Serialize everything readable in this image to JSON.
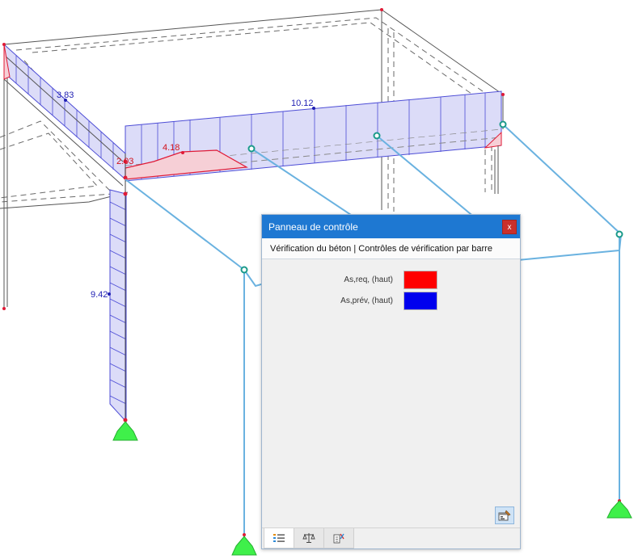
{
  "diagram": {
    "labels": {
      "left_beam_value": "3.83",
      "front_beam_value": "10.12",
      "red_peak_value": "4.18",
      "red_end_value": "2.03",
      "column_value": "9.42"
    },
    "colors": {
      "member_line": "#5b5b5b",
      "dashed_edge": "#6a6a6a",
      "reinforcement_blue_fill": "#dcdcf8",
      "reinforcement_blue_line": "#4d4dd6",
      "required_red_fill": "#f6cfd6",
      "required_red_line": "#e01a36",
      "cable": "#6ab2e0",
      "support": "#3ff04a",
      "node_ring": "#1a9a8a"
    }
  },
  "control_panel": {
    "title": "Panneau de contrôle",
    "close_label": "x",
    "subtitle": "Vérification du béton | Contrôles de vérification par barre",
    "legend": [
      {
        "label": "As,req, (haut)",
        "color": "#ff0000"
      },
      {
        "label": "As,prév, (haut)",
        "color": "#0000ee"
      }
    ],
    "tabs": [
      {
        "name": "tab-list",
        "icon": "list-icon"
      },
      {
        "name": "tab-scale",
        "icon": "balance-scale-icon"
      },
      {
        "name": "tab-settings",
        "icon": "display-settings-icon"
      }
    ]
  }
}
